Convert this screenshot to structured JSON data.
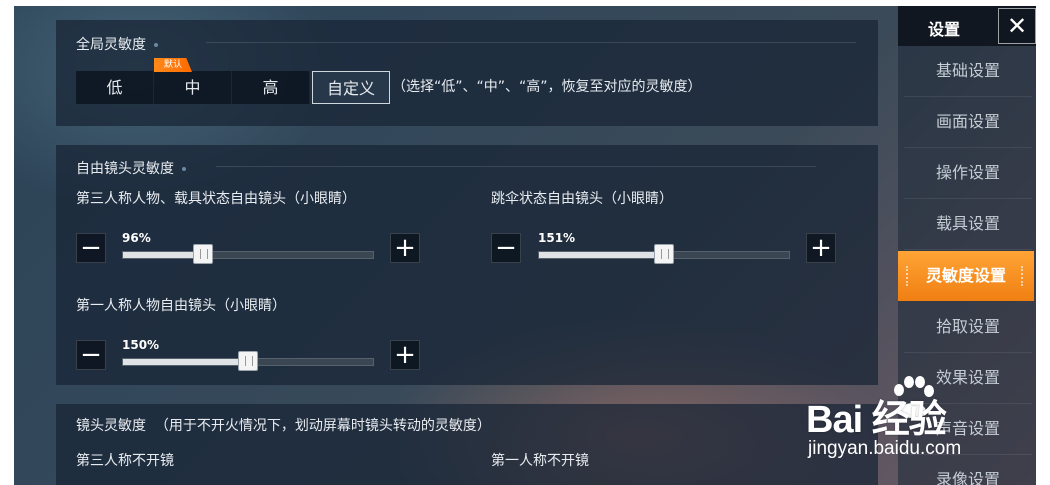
{
  "global": {
    "title": "全局灵敏度",
    "options": [
      "低",
      "中",
      "高",
      "自定义"
    ],
    "default_badge": "默认",
    "hint": "（选择“低”、“中”、“高”，恢复至对应的灵敏度）"
  },
  "free_camera": {
    "title": "自由镜头灵敏度",
    "sliders": [
      {
        "label": "第三人称人物、载具状态自由镜头（小眼睛）",
        "value_text": "96%",
        "fraction": 0.32
      },
      {
        "label": "跳伞状态自由镜头（小眼睛）",
        "value_text": "151%",
        "fraction": 0.5
      },
      {
        "label": "第一人称人物自由镜头（小眼睛）",
        "value_text": "150%",
        "fraction": 0.5
      }
    ],
    "minus": "−",
    "plus": "+"
  },
  "lens": {
    "title": "镜头灵敏度",
    "subtitle": "（用于不开火情况下，划动屏幕时镜头转动的灵敏度）",
    "col1": "第三人称不开镜",
    "col2": "第一人称不开镜"
  },
  "sidebar": {
    "title": "设置",
    "close": "✕",
    "items": [
      "基础设置",
      "画面设置",
      "操作设置",
      "载具设置",
      "灵敏度设置",
      "拾取设置",
      "效果设置",
      "声音设置",
      "录像设置"
    ],
    "active_index": 4
  },
  "watermark": {
    "brand": "Bai  经验",
    "url": "jingyan.baidu.com"
  },
  "colors": {
    "accent": "#f59226",
    "panel": "#182434"
  }
}
